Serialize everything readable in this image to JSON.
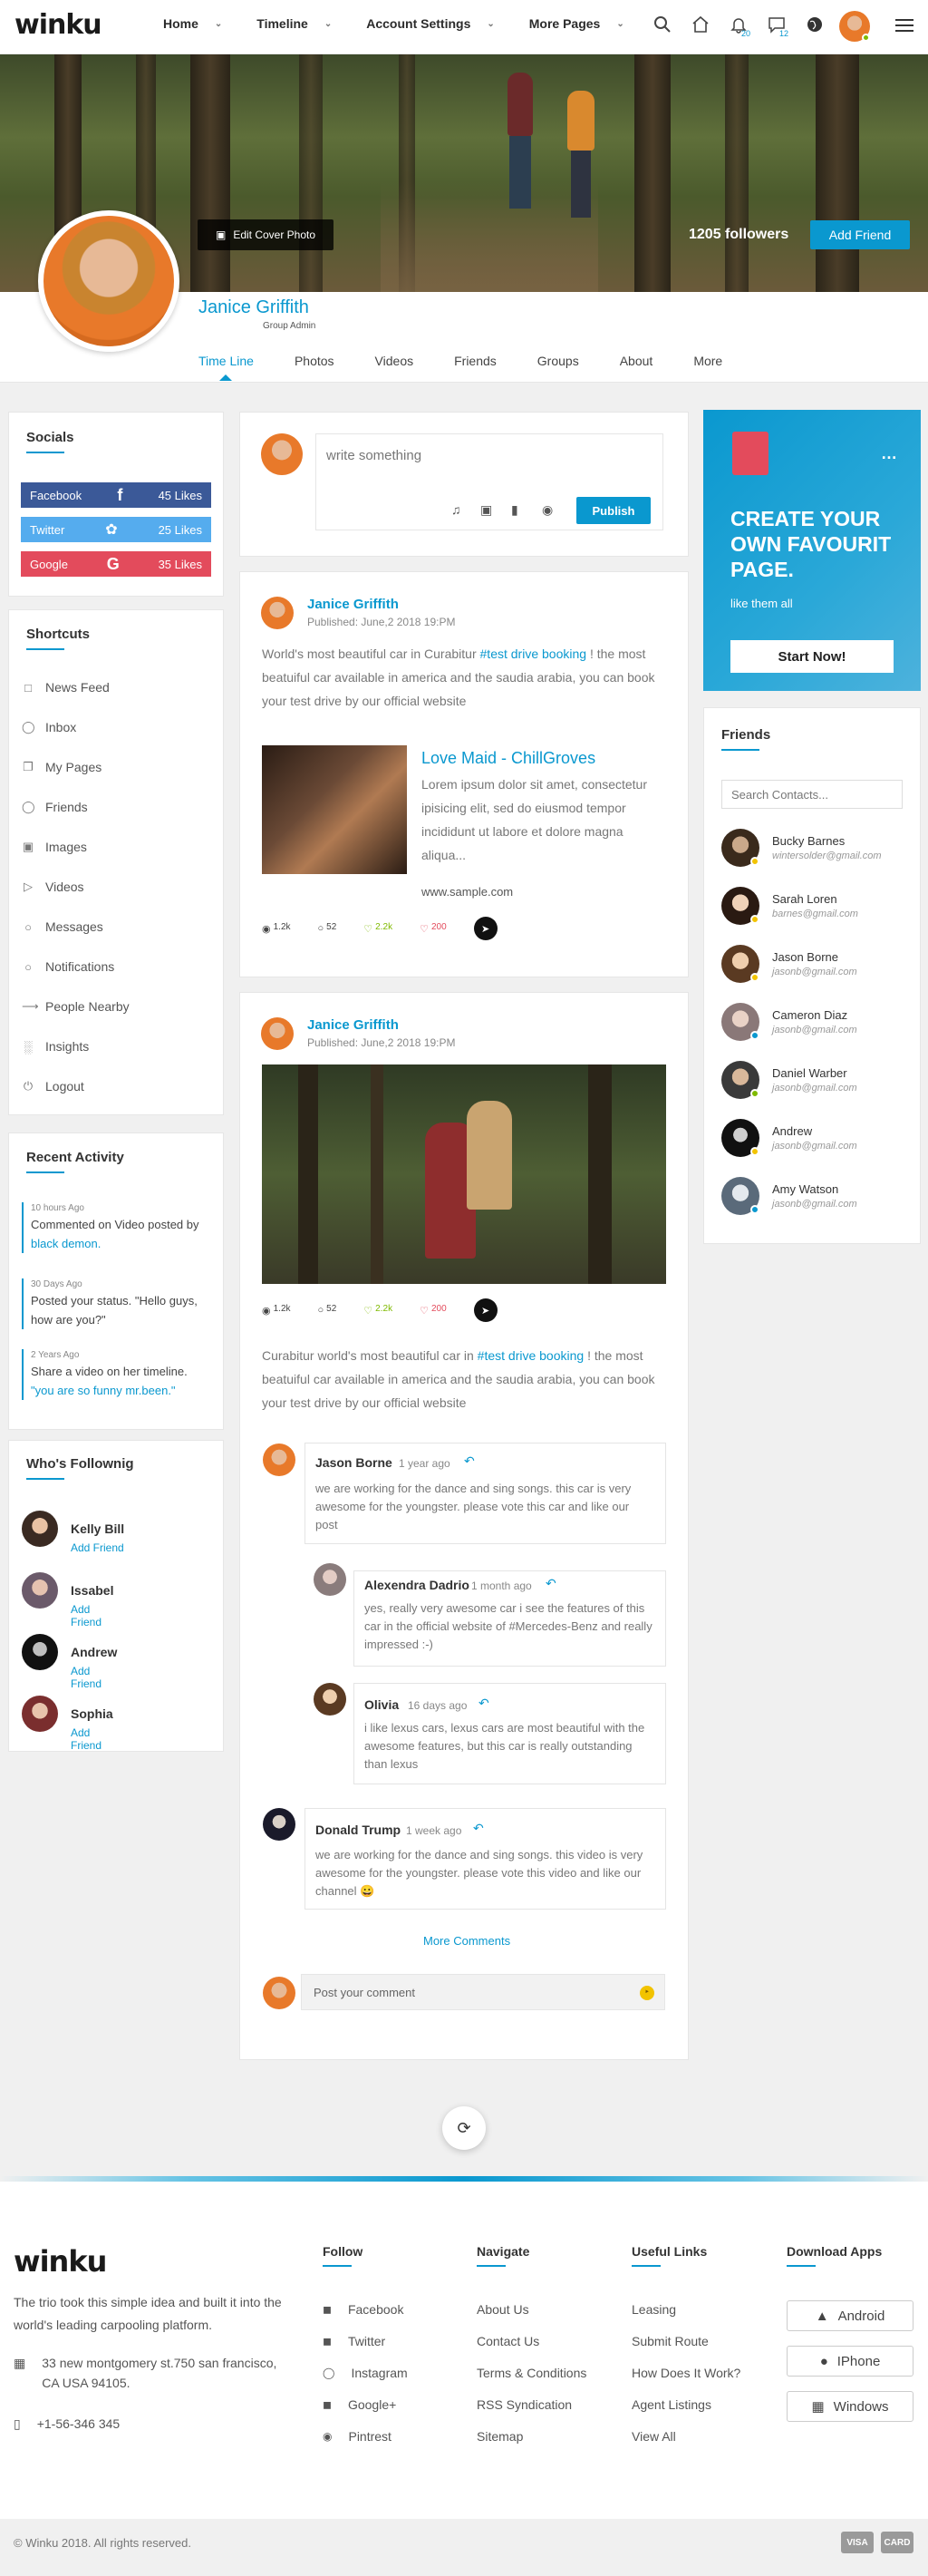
{
  "brand": {
    "logo_text": "winku",
    "accent": "#0a98cf"
  },
  "topnav": {
    "items": [
      {
        "label": "Home"
      },
      {
        "label": "Timeline"
      },
      {
        "label": "Account Settings"
      },
      {
        "label": "More Pages"
      }
    ],
    "notif_count": "20",
    "msg_count": "12"
  },
  "profile": {
    "name": "Janice Griffith",
    "role": "Group Admin",
    "edit_cover": "Edit Cover Photo",
    "followers": "1205 followers",
    "add_friend": "Add Friend",
    "tabs": [
      "Time Line",
      "Photos",
      "Videos",
      "Friends",
      "Groups",
      "About",
      "More"
    ]
  },
  "socials": {
    "title": "Socials",
    "items": [
      {
        "name": "Facebook",
        "likes": "45 Likes",
        "color": "#3b5998"
      },
      {
        "name": "Twitter",
        "likes": "25 Likes",
        "color": "#55acee"
      },
      {
        "name": "Google",
        "likes": "35 Likes",
        "color": "#e34b5c"
      }
    ]
  },
  "shortcuts": {
    "title": "Shortcuts",
    "items": [
      "News Feed",
      "Inbox",
      "My Pages",
      "Friends",
      "Images",
      "Videos",
      "Messages",
      "Notifications",
      "People Nearby",
      "Insights",
      "Logout"
    ]
  },
  "recent": {
    "title": "Recent Activity",
    "items": [
      {
        "time": "10 hours Ago",
        "text": "Commented on Video posted by",
        "link": "black demon."
      },
      {
        "time": "30 Days Ago",
        "text": "Posted your status. \"Hello guys, how are you?\"",
        "link": ""
      },
      {
        "time": "2 Years Ago",
        "text": "Share a video on her timeline.",
        "link": "\"you are so funny mr.been.\""
      }
    ]
  },
  "following": {
    "title": "Who's Follownig",
    "add_label": "Add Friend",
    "items": [
      "Kelly Bill",
      "Issabel",
      "Andrew",
      "Sophia"
    ]
  },
  "composer": {
    "placeholder": "write something",
    "publish": "Publish"
  },
  "post1": {
    "author": "Janice Griffith",
    "date": "Published: June,2 2018 19:PM",
    "text_before": "World's most beautiful car in Curabitur",
    "tag": "#test drive booking",
    "text_after": "! the most beatuiful car available in america and the saudia arabia, you can book your test drive by our official website",
    "link_title": "Love Maid - ChillGroves",
    "link_desc": "Lorem ipsum dolor sit amet, consectetur ipisicing elit, sed do eiusmod tempor incididunt ut labore et dolore magna aliqua...",
    "link_url": "www.sample.com",
    "stats": {
      "views": "1.2k",
      "comments": "52",
      "likes": "2.2k",
      "dislikes": "200"
    }
  },
  "post2": {
    "author": "Janice Griffith",
    "date": "Published: June,2 2018 19:PM",
    "stats": {
      "views": "1.2k",
      "comments": "52",
      "likes": "2.2k",
      "dislikes": "200"
    },
    "text_before": "Curabitur world's most beautiful car in",
    "tag": "#test drive booking",
    "text_after": "! the most beatuiful car available in america and the saudia arabia, you can book your test drive by our official website"
  },
  "comments": [
    {
      "name": "Jason Borne",
      "time": "1 year ago",
      "text": "we are working for the dance and sing songs. this car is very awesome for the youngster. please vote this car and like our post"
    },
    {
      "name": "Alexendra Dadrio",
      "time": "1 month ago",
      "text": "yes, really very awesome car i see the features of this car in the official website of #Mercedes-Benz and really impressed :-)"
    },
    {
      "name": "Olivia",
      "time": "16 days ago",
      "text": "i like lexus cars, lexus cars are most beautiful with the awesome features, but this car is really outstanding than lexus"
    },
    {
      "name": "Donald Trump",
      "time": "1 week ago",
      "text": "we are working for the dance and sing songs. this video is very awesome for the youngster. please vote this video and like our channel 😀"
    }
  ],
  "more_comments": "More Comments",
  "post_comment_placeholder": "Post your comment",
  "ad": {
    "title": "CREATE YOUR OWN FAVOURIT PAGE.",
    "sub": "like them all",
    "button": "Start Now!"
  },
  "friends": {
    "title": "Friends",
    "search_placeholder": "Search Contacts...",
    "items": [
      {
        "name": "Bucky Barnes",
        "email": "wintersolder@gmail.com",
        "status": "#f2c300"
      },
      {
        "name": "Sarah Loren",
        "email": "barnes@gmail.com",
        "status": "#f2c300"
      },
      {
        "name": "Jason Borne",
        "email": "jasonb@gmail.com",
        "status": "#f2c300"
      },
      {
        "name": "Cameron Diaz",
        "email": "jasonb@gmail.com",
        "status": "#0a98cf"
      },
      {
        "name": "Daniel Warber",
        "email": "jasonb@gmail.com",
        "status": "#7fba00"
      },
      {
        "name": "Andrew",
        "email": "jasonb@gmail.com",
        "status": "#f2c300"
      },
      {
        "name": "Amy Watson",
        "email": "jasonb@gmail.com",
        "status": "#0a98cf"
      }
    ]
  },
  "footer": {
    "about": "The trio took this simple idea and built it into the world's leading carpooling platform.",
    "address": "33 new montgomery st.750 san francisco, CA USA 94105.",
    "phone": "+1-56-346 345",
    "follow_title": "Follow",
    "follow": [
      "Facebook",
      "Twitter",
      "Instagram",
      "Google+",
      "Pintrest"
    ],
    "navigate_title": "Navigate",
    "navigate": [
      "About Us",
      "Contact Us",
      "Terms & Conditions",
      "RSS Syndication",
      "Sitemap"
    ],
    "useful_title": "Useful Links",
    "useful": [
      "Leasing",
      "Submit Route",
      "How Does It Work?",
      "Agent Listings",
      "View All"
    ],
    "apps_title": "Download Apps",
    "apps": [
      "Android",
      "IPhone",
      "Windows"
    ],
    "copyright": "© Winku 2018. All rights reserved.",
    "cards": [
      "VISA",
      "CARD"
    ]
  }
}
